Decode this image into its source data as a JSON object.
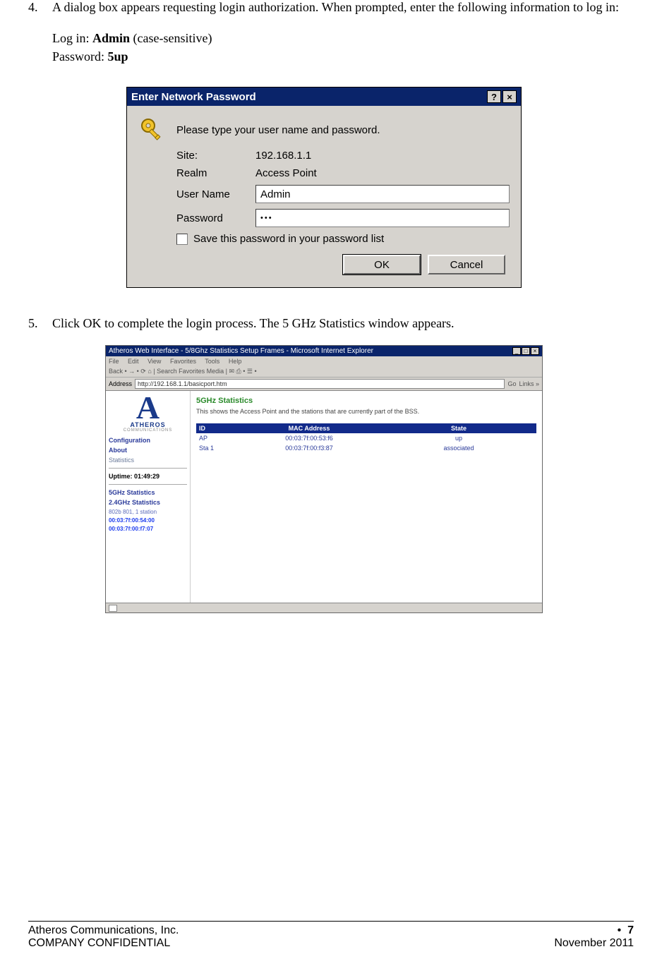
{
  "step4": {
    "num": "4.",
    "text": "A dialog box appears requesting login authorization. When prompted, enter the following information to log in:",
    "login_label": "Log in: ",
    "login_value": "Admin",
    "login_suffix": " (case-sensitive)",
    "password_label": "Password: ",
    "password_value": "5up"
  },
  "dialog": {
    "title": "Enter Network Password",
    "help_btn": "?",
    "close_btn": "×",
    "prompt": "Please type your user name and password.",
    "site_label": "Site:",
    "site_value": "192.168.1.1",
    "realm_label": "Realm",
    "realm_value": "Access Point",
    "user_label": "User Name",
    "user_value": "Admin",
    "pass_label": "Password",
    "pass_value": "•••",
    "save_label": "Save this password in your password list",
    "ok": "OK",
    "cancel": "Cancel"
  },
  "step5": {
    "num": "5.",
    "text": "Click OK to complete the login process. The 5 GHz Statistics window appears."
  },
  "browser": {
    "title": "Atheros Web Interface - 5/8Ghz Statistics Setup Frames - Microsoft Internet Explorer",
    "menus": [
      "File",
      "Edit",
      "View",
      "Favorites",
      "Tools",
      "Help"
    ],
    "toolbar": "Back  •  →  •  ⟳  ⌂  | Search  Favorites  Media  | ✉  ⎙  • ☰ •",
    "addr_label": "Address",
    "url": "http://192.168.1.1/basicport.htm",
    "go": "Go",
    "links": "Links »",
    "brand": "ATHEROS",
    "brand_sub": "COMMUNICATIONS",
    "side_links": [
      "Configuration",
      "About",
      "Statistics"
    ],
    "side_header": "Uptime: 01:49:29",
    "side_stats": [
      "5GHz Statistics",
      "2.4GHz Statistics"
    ],
    "side_items": [
      "802b 801, 1 station",
      "00:03:7f:00:54:00",
      "00:03:7f:00:f7:07"
    ],
    "main_title": "5GHz Statistics",
    "main_desc": "This shows the Access Point and the stations that are currently part of the BSS.",
    "th": [
      "ID",
      "MAC Address",
      "State"
    ],
    "rows": [
      {
        "id": "AP",
        "mac": "00:03:7f:00:53:f6",
        "state": "up"
      },
      {
        "id": "Sta 1",
        "mac": "00:03:7f:00:f3:87",
        "state": "associated"
      }
    ]
  },
  "footer": {
    "company": "Atheros Communications, Inc.",
    "confidential": "COMPANY CONFIDENTIAL",
    "bullet": "•",
    "page": "7",
    "date": "November 2011"
  }
}
